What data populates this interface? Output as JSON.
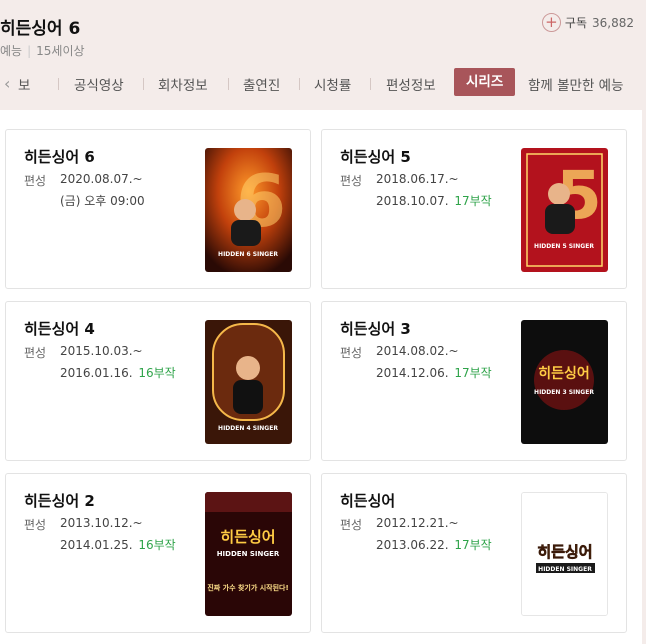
{
  "header": {
    "title": "히든싱어 6",
    "genre": "예능",
    "rating": "15세이상",
    "subscribe_label": "구독",
    "subscribe_count": "36,882"
  },
  "tabs": [
    {
      "label": "보"
    },
    {
      "label": "공식영상"
    },
    {
      "label": "회차정보"
    },
    {
      "label": "출연진"
    },
    {
      "label": "시청률"
    },
    {
      "label": "편성정보"
    },
    {
      "label": "시리즈"
    },
    {
      "label": "함께 볼만한 예능"
    }
  ],
  "series": [
    {
      "title": "히든싱어 6",
      "label": "편성",
      "start": "2020.08.07.~",
      "end": "(금) 오후 09:00",
      "episodes": ""
    },
    {
      "title": "히든싱어 5",
      "label": "편성",
      "start": "2018.06.17.~",
      "end": "2018.10.07.",
      "episodes": "17부작"
    },
    {
      "title": "히든싱어 4",
      "label": "편성",
      "start": "2015.10.03.~",
      "end": "2016.01.16.",
      "episodes": "16부작"
    },
    {
      "title": "히든싱어 3",
      "label": "편성",
      "start": "2014.08.02.~",
      "end": "2014.12.06.",
      "episodes": "17부작"
    },
    {
      "title": "히든싱어 2",
      "label": "편성",
      "start": "2013.10.12.~",
      "end": "2014.01.25.",
      "episodes": "16부작"
    },
    {
      "title": "히든싱어",
      "label": "편성",
      "start": "2012.12.21.~",
      "end": "2013.06.22.",
      "episodes": "17부작"
    }
  ],
  "posters": {
    "s6_logo": "HIDDEN 6 SINGER",
    "s5_logo": "HIDDEN 5 SINGER",
    "s4_logo": "HIDDEN 4 SINGER",
    "s3_logo": "HIDDEN 3 SINGER",
    "s2_logo": "HIDDEN SINGER",
    "s2_slogan": "진짜 가수 찾기가 시작된다!",
    "s1_logo": "HIDDEN SINGER"
  }
}
